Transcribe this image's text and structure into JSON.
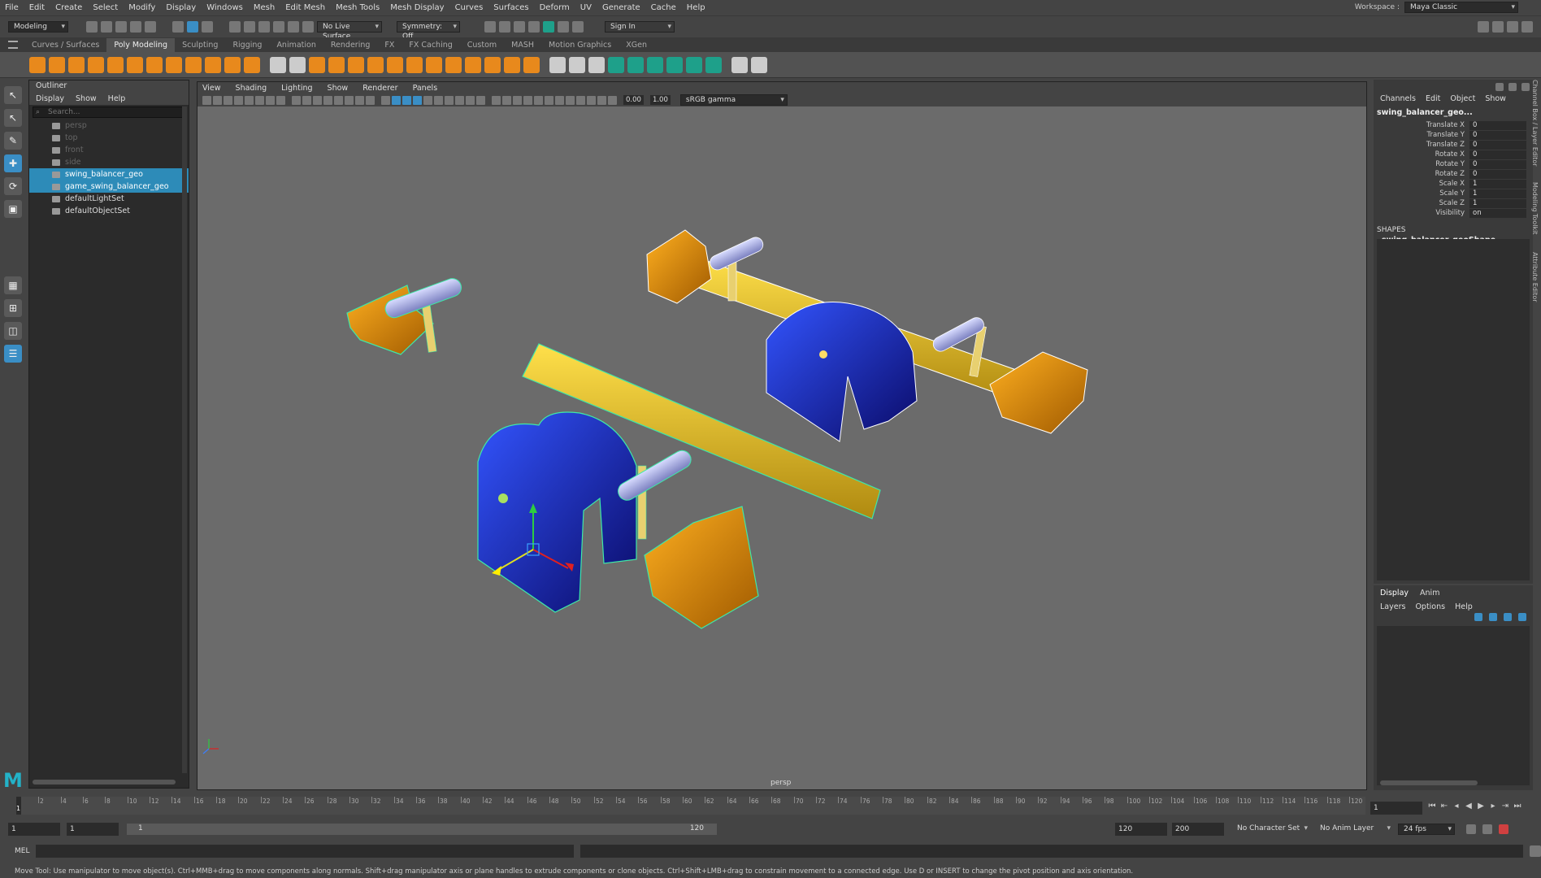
{
  "menubar": {
    "items": [
      "File",
      "Edit",
      "Create",
      "Select",
      "Modify",
      "Display",
      "Windows",
      "Mesh",
      "Edit Mesh",
      "Mesh Tools",
      "Mesh Display",
      "Curves",
      "Surfaces",
      "Deform",
      "UV",
      "Generate",
      "Cache",
      "Help"
    ],
    "workspace_label": "Workspace :",
    "workspace_value": "Maya Classic"
  },
  "statusline": {
    "mode": "Modeling",
    "live_surface": "No Live Surface",
    "symmetry": "Symmetry: Off",
    "sign_in": "Sign In"
  },
  "shelf": {
    "tabs": [
      "Curves / Surfaces",
      "Poly Modeling",
      "Sculpting",
      "Rigging",
      "Animation",
      "Rendering",
      "FX",
      "FX Caching",
      "Custom",
      "MASH",
      "Motion Graphics",
      "XGen"
    ],
    "active_tab": "Poly Modeling",
    "icon_colors": [
      "#e8891c",
      "#e8891c",
      "#e8891c",
      "#e8891c",
      "#e8891c",
      "#e8891c",
      "#e8891c",
      "#e8891c",
      "#e8891c",
      "#e8891c",
      "#e8891c",
      "#e8891c",
      "#cccccc",
      "#cccccc",
      "#e8891c",
      "#e8891c",
      "#e8891c",
      "#e8891c",
      "#e8891c",
      "#e8891c",
      "#e8891c",
      "#e8891c",
      "#e8891c",
      "#e8891c",
      "#e8891c",
      "#e8891c",
      "#cccccc",
      "#cccccc",
      "#cccccc",
      "#1ea08a",
      "#1ea08a",
      "#1ea08a",
      "#1ea08a",
      "#1ea08a",
      "#1ea08a",
      "#cccccc",
      "#cccccc"
    ]
  },
  "outliner": {
    "title": "Outliner",
    "menu": [
      "Display",
      "Show",
      "Help"
    ],
    "search_placeholder": "Search...",
    "items": [
      {
        "label": "persp",
        "state": "dim"
      },
      {
        "label": "top",
        "state": "dim"
      },
      {
        "label": "front",
        "state": "dim"
      },
      {
        "label": "side",
        "state": "dim"
      },
      {
        "label": "swing_balancer_geo",
        "state": "sel"
      },
      {
        "label": "game_swing_balancer_geo",
        "state": "sel"
      },
      {
        "label": "defaultLightSet",
        "state": "normal"
      },
      {
        "label": "defaultObjectSet",
        "state": "normal"
      }
    ]
  },
  "viewport": {
    "menu": [
      "View",
      "Shading",
      "Lighting",
      "Show",
      "Renderer",
      "Panels"
    ],
    "exposure": "0.00",
    "gamma": "1.00",
    "color_space": "sRGB gamma",
    "camera_label": "persp"
  },
  "channelbox": {
    "menu": [
      "Channels",
      "Edit",
      "Object",
      "Show"
    ],
    "object_name": "swing_balancer_geo...",
    "attributes": [
      {
        "name": "Translate X",
        "value": "0"
      },
      {
        "name": "Translate Y",
        "value": "0"
      },
      {
        "name": "Translate Z",
        "value": "0"
      },
      {
        "name": "Rotate X",
        "value": "0"
      },
      {
        "name": "Rotate Y",
        "value": "0"
      },
      {
        "name": "Rotate Z",
        "value": "0"
      },
      {
        "name": "Scale X",
        "value": "1"
      },
      {
        "name": "Scale Y",
        "value": "1"
      },
      {
        "name": "Scale Z",
        "value": "1"
      },
      {
        "name": "Visibility",
        "value": "on"
      }
    ],
    "shapes_header": "SHAPES",
    "shape_name": "swing_balancer_geoShape"
  },
  "layers": {
    "tabs": [
      "Display",
      "Anim"
    ],
    "active_tab": "Display",
    "menu": [
      "Layers",
      "Options",
      "Help"
    ]
  },
  "side_tabs": [
    "Channel Box / Layer Editor",
    "Modeling Toolkit",
    "Attribute Editor"
  ],
  "timeslider": {
    "ticks": [
      "2",
      "4",
      "6",
      "8",
      "10",
      "12",
      "14",
      "16",
      "18",
      "20",
      "22",
      "24",
      "26",
      "28",
      "30",
      "32",
      "34",
      "36",
      "38",
      "40",
      "42",
      "44",
      "46",
      "48",
      "50",
      "52",
      "54",
      "56",
      "58",
      "60",
      "62",
      "64",
      "66",
      "68",
      "70",
      "72",
      "74",
      "76",
      "78",
      "80",
      "82",
      "84",
      "86",
      "88",
      "90",
      "92",
      "94",
      "96",
      "98",
      "100",
      "102",
      "104",
      "106",
      "108",
      "110",
      "112",
      "114",
      "116",
      "118",
      "120"
    ],
    "current_frame_marker": "1",
    "current_frame": "1"
  },
  "range": {
    "start": "1",
    "playback_start": "1",
    "slider_start": "1",
    "slider_end": "120",
    "playback_end": "120",
    "end": "200",
    "character_set": "No Character Set",
    "anim_layer": "No Anim Layer",
    "fps": "24 fps"
  },
  "cmdline": {
    "lang": "MEL"
  },
  "helpline": "Move Tool: Use manipulator to move object(s). Ctrl+MMB+drag to move components along normals. Shift+drag manipulator axis or plane handles to extrude components or clone objects. Ctrl+Shift+LMB+drag to constrain movement to a connected edge. Use D or INSERT to change the pivot position and axis orientation.",
  "colors": {
    "selection": "#2d8bb8",
    "accent_orange": "#e8891c",
    "maya_logo": "#23b2c8"
  }
}
